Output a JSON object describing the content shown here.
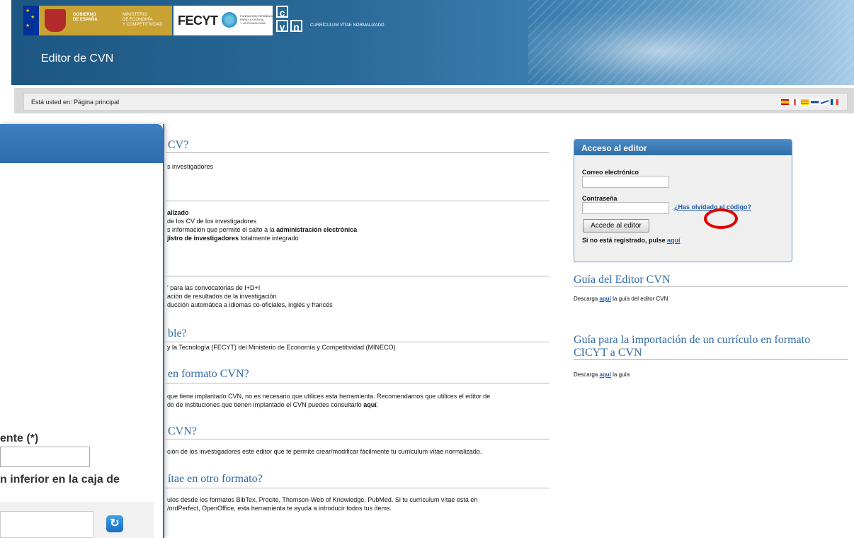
{
  "header": {
    "gov_text": "GOBIERNO\nDE ESPAÑA",
    "ministry_text": "MINISTERIO\nDE ECONOMÍA\nY COMPETITIVIDAD",
    "fecyt_name": "FECYT",
    "fecyt_small": "FUNDACIÓN ESPAÑOLA\nPARA LA CIENCIA\nY LA TECNOLOGÍA",
    "cvn_c": "c",
    "cvn_v": "v",
    "cvn_n": "n",
    "cvn_caption": "CURRÍCULUM VÍTAE NORMALIZADO",
    "editor_title": "Editor de CVN"
  },
  "breadcrumb": {
    "text": "Está usted en: Página principal",
    "languages": [
      "es-flag",
      "en-flag",
      "ca-flag",
      "gl-flag",
      "eu-flag",
      "fr-flag"
    ]
  },
  "main": {
    "sections": [
      {
        "heading": "CV?",
        "lines": [
          "s investigadores"
        ]
      },
      {
        "lines_html": [
          "alizado",
          "de los CV de los investigadores",
          "s información que permite el salto a la |administración electrónica",
          "jistro de investigadores| totalmente integrado"
        ]
      },
      {
        "lines": [
          "' para las convocatorias de I+D+I",
          "ación de resultados de la investigación",
          "ducción automática a idiomas co-oficiales, inglés y francés"
        ]
      },
      {
        "heading": "ble?",
        "lines": [
          "y la Tecnología (FECYT) del Ministerio de Economía y Competitividad (MINECO)"
        ]
      },
      {
        "heading": "en formato CVN?",
        "lines": [
          "que tiene implantado CVN, no es necesario que utilices esta herramienta. Recomendamos que utilices el editor de",
          "do de instituciones que tienen implantado el CVN puedes consultarlo |aquí|."
        ]
      },
      {
        "heading": "CVN?",
        "lines": [
          "ción de los investigadores este editor que te permite crear/modificar fácilmente tu currículum vítae normalizado."
        ]
      },
      {
        "heading": "ítae en otro formato?",
        "lines": [
          "ulos desde los formatos BibTex, Procite, Thomson-Web of Knowledge, PubMed. Si tu currículum vítae está en",
          "/ordPerfect, OpenOffice, esta herramienta te ayuda a introducir todos tus ítems."
        ]
      }
    ],
    "s1_heading": "CV?",
    "s1_l1": "s investigadores",
    "s2_l1": "alizado",
    "s2_l2": "de los CV de los investigadores",
    "s2_l3a": "s información que permite el salto a la ",
    "s2_l3b": "administración electrónica",
    "s2_l4a": "jistro de investigadores",
    "s2_l4b": " totalmente integrado",
    "s3_l1": "' para las convocatorias de I+D+I",
    "s3_l2": "ación de resultados de la investigación",
    "s3_l3": "ducción automática a idiomas co-oficiales, inglés y francés",
    "s4_heading": "ble?",
    "s4_l1": "y la Tecnología (FECYT) del Ministerio de Economía y Competitividad (MINECO)",
    "s5_heading": "en formato CVN?",
    "s5_l1": "que tiene implantado CVN, no es necesario que utilices esta herramienta. Recomendamos que utilices el editor de",
    "s5_l2a": "do de instituciones que tienen implantado el CVN puedes consultarlo ",
    "s5_l2b": "aquí",
    "s5_l2c": ".",
    "s6_heading": "CVN?",
    "s6_l1": "ción de los investigadores este editor que te permite crear/modificar fácilmente tu currículum vítae normalizado.",
    "s7_heading": "ítae en otro formato?",
    "s7_l1": "ulos desde los formatos BibTex, Procite, Thomson-Web of Knowledge, PubMed. Si tu currículum vítae está en",
    "s7_l2": "/ordPerfect, OpenOffice, esta herramienta te ayuda a introducir todos tus ítems."
  },
  "overlay": {
    "label1": "ente (*)",
    "label2": "n inferior en la caja de",
    "refresh_glyph": "↻"
  },
  "login": {
    "title": "Acceso al editor",
    "email_label": "Correo electrónico",
    "password_label": "Contraseña",
    "forgot_link": "¿Has olvidado el código?",
    "submit_label": "Accede al editor",
    "register_text": "Si no está registrado, pulse ",
    "register_link": "aquí"
  },
  "sidebar": {
    "guide_heading": "Guía del Editor CVN",
    "guide_pre": "Descarga ",
    "guide_link": "aquí",
    "guide_post": " la guía del editor CVN",
    "import_heading": "Guía para la importación de un currículo en formato CICYT a CVN",
    "import_pre": "Descarga ",
    "import_link": "aquí",
    "import_post": " la guía"
  },
  "colors": {
    "header_blue": "#2b6a98",
    "heading_blue": "#2f6aa5",
    "link_blue": "#1f5ea8",
    "highlight_red": "#e00000"
  }
}
